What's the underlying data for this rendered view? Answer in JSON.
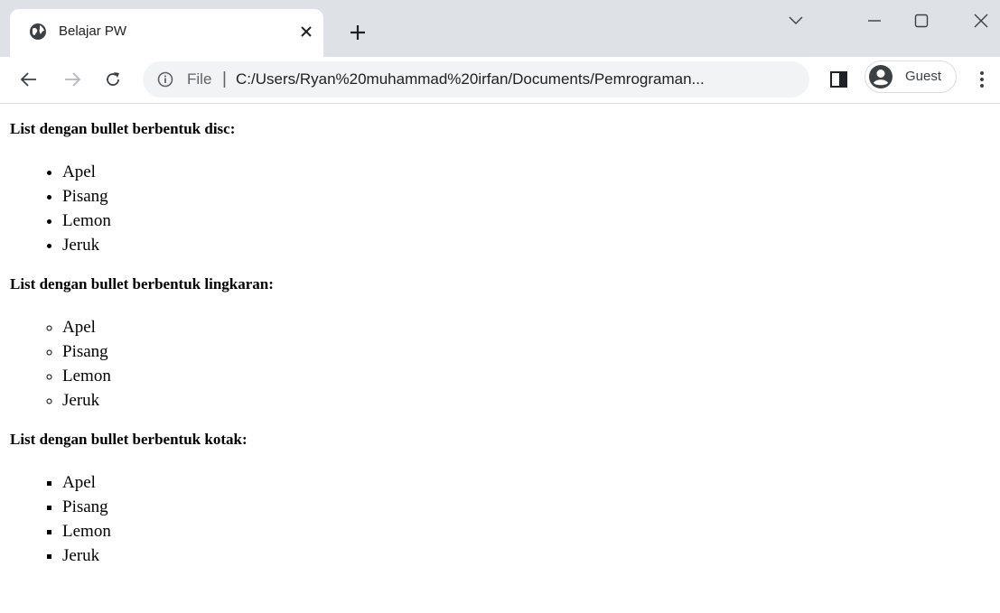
{
  "browser": {
    "tab": {
      "title": "Belajar PW"
    },
    "address_bar": {
      "scheme": "File",
      "separator": "|",
      "url": "C:/Users/Ryan%20muhammad%20irfan/Documents/Pemrograman..."
    },
    "profile": {
      "label": "Guest"
    }
  },
  "page": {
    "sections": [
      {
        "heading": "List dengan bullet berbentuk disc:",
        "items": [
          "Apel",
          "Pisang",
          "Lemon",
          "Jeruk"
        ]
      },
      {
        "heading": "List dengan bullet berbentuk lingkaran:",
        "items": [
          "Apel",
          "Pisang",
          "Lemon",
          "Jeruk"
        ]
      },
      {
        "heading": "List dengan bullet berbentuk kotak:",
        "items": [
          "Apel",
          "Pisang",
          "Lemon",
          "Jeruk"
        ]
      }
    ]
  },
  "icons": {
    "favicon": "globe-icon",
    "tab_close": "close-icon",
    "new_tab": "plus-icon",
    "tab_search": "chevron-down-icon",
    "minimize": "minimize-icon",
    "maximize": "maximize-icon",
    "close_window": "close-window-icon",
    "back": "back-arrow-icon",
    "forward": "forward-arrow-icon",
    "reload": "reload-icon",
    "info": "info-icon",
    "side_panel": "side-panel-icon",
    "avatar": "person-icon",
    "menu": "kebab-menu-icon"
  },
  "colors": {
    "tabstrip": "#dee1e6",
    "omnibox": "#f1f3f4",
    "text": "#202124",
    "muted": "#5f6368"
  }
}
